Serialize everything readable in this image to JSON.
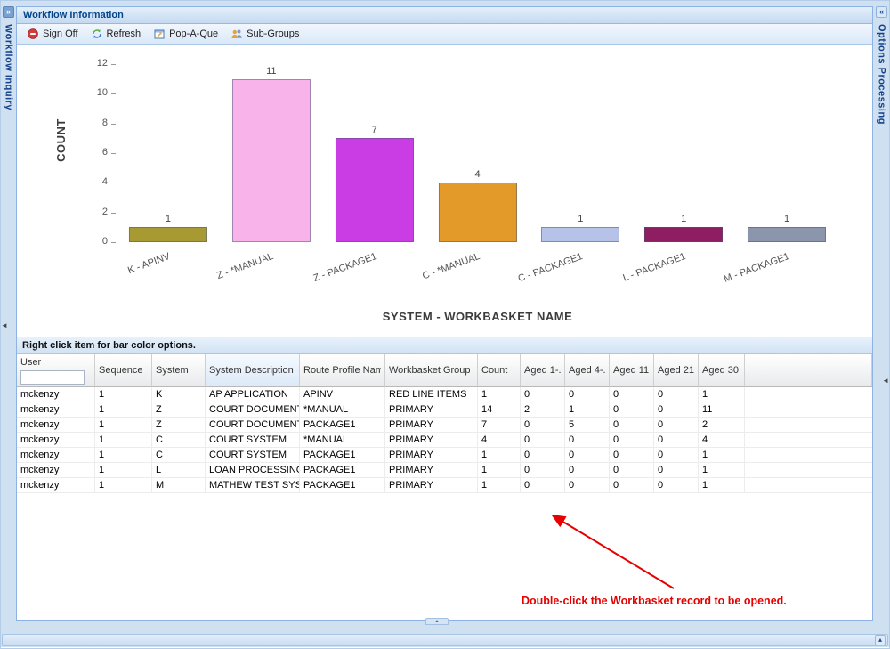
{
  "window": {
    "title": "Workflow Information"
  },
  "left_panel": {
    "title": "Workflow Inquiry",
    "expand_glyph": "»"
  },
  "right_panel": {
    "title": "Options Processing",
    "collapse_glyph": "«"
  },
  "frame": {
    "left_collapse_glyph": "◄",
    "right_collapse_glyph": "◄",
    "splitter_glyph": "▴",
    "south_expand_glyph": "▴"
  },
  "toolbar": {
    "buttons": [
      {
        "label": "Sign Off",
        "icon": "sign-off-icon"
      },
      {
        "label": "Refresh",
        "icon": "refresh-icon"
      },
      {
        "label": "Pop-A-Que",
        "icon": "pop-a-que-icon"
      },
      {
        "label": "Sub-Groups",
        "icon": "sub-groups-icon"
      }
    ]
  },
  "chart_data": {
    "type": "bar",
    "title": "",
    "xlabel": "SYSTEM - WORKBASKET NAME",
    "ylabel": "COUNT",
    "ylim": [
      0,
      12
    ],
    "yticks": [
      0,
      2,
      4,
      6,
      8,
      10,
      12
    ],
    "grid": false,
    "categories": [
      "K - APINV",
      "Z - *MANUAL",
      "Z - PACKAGE1",
      "C - *MANUAL",
      "C - PACKAGE1",
      "L - PACKAGE1",
      "M - PACKAGE1"
    ],
    "values": [
      1,
      11,
      7,
      4,
      1,
      1,
      1
    ],
    "bar_colors": [
      "#a79a33",
      "#f8b4ea",
      "#cb3de4",
      "#e39a28",
      "#b6c2e8",
      "#8e1d62",
      "#8b95ac"
    ]
  },
  "grid": {
    "hint": "Right click item for bar color options.",
    "sorted_column_index": 3,
    "sort_dir": "asc",
    "sort_glyph": "▲",
    "user_filter_value": "",
    "columns": [
      "User",
      "Sequence",
      "System",
      "System Description",
      "Route Profile Name",
      "Workbasket Group",
      "Count",
      "Aged 1-...",
      "Aged 4-...",
      "Aged 11...",
      "Aged 21...",
      "Aged 30..."
    ],
    "rows": [
      [
        "mckenzy",
        "1",
        "K",
        "AP APPLICATION",
        "APINV",
        "RED LINE ITEMS",
        "1",
        "0",
        "0",
        "0",
        "0",
        "1"
      ],
      [
        "mckenzy",
        "1",
        "Z",
        "COURT DOCUMENTS...",
        "*MANUAL",
        "PRIMARY",
        "14",
        "2",
        "1",
        "0",
        "0",
        "11"
      ],
      [
        "mckenzy",
        "1",
        "Z",
        "COURT DOCUMENTS...",
        "PACKAGE1",
        "PRIMARY",
        "7",
        "0",
        "5",
        "0",
        "0",
        "2"
      ],
      [
        "mckenzy",
        "1",
        "C",
        "COURT SYSTEM",
        "*MANUAL",
        "PRIMARY",
        "4",
        "0",
        "0",
        "0",
        "0",
        "4"
      ],
      [
        "mckenzy",
        "1",
        "C",
        "COURT SYSTEM",
        "PACKAGE1",
        "PRIMARY",
        "1",
        "0",
        "0",
        "0",
        "0",
        "1"
      ],
      [
        "mckenzy",
        "1",
        "L",
        "LOAN PROCESSING",
        "PACKAGE1",
        "PRIMARY",
        "1",
        "0",
        "0",
        "0",
        "0",
        "1"
      ],
      [
        "mckenzy",
        "1",
        "M",
        "MATHEW TEST SYST...",
        "PACKAGE1",
        "PRIMARY",
        "1",
        "0",
        "0",
        "0",
        "0",
        "1"
      ]
    ]
  },
  "annotation": {
    "text": "Double-click the Workbasket record to be opened.",
    "color": "#e60000"
  }
}
